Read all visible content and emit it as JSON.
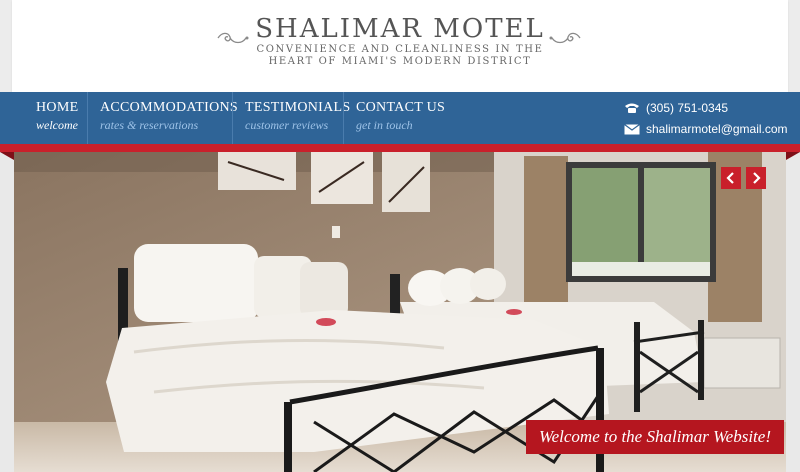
{
  "site": {
    "title": "SHALIMAR MOTEL",
    "tagline_line1": "CONVENIENCE AND CLEANLINESS IN THE",
    "tagline_line2": "HEART OF MIAMI'S MODERN DISTRICT"
  },
  "nav": {
    "items": [
      {
        "label": "HOME",
        "sub": "welcome"
      },
      {
        "label": "ACCOMMODATIONS",
        "sub": "rates & reservations"
      },
      {
        "label": "TESTIMONIALS",
        "sub": "customer reviews"
      },
      {
        "label": "CONTACT US",
        "sub": "get in touch"
      }
    ],
    "phone": "(305) 751-0345",
    "email": "shalimarmotel@gmail.com"
  },
  "slider": {
    "caption": "Welcome to the Shalimar Website!",
    "prev_icon": "chevron-left-icon",
    "next_icon": "chevron-right-icon"
  },
  "colors": {
    "nav_blue": "#2f6497",
    "accent_red": "#c9202b",
    "sub_text": "#9ec3e8"
  }
}
